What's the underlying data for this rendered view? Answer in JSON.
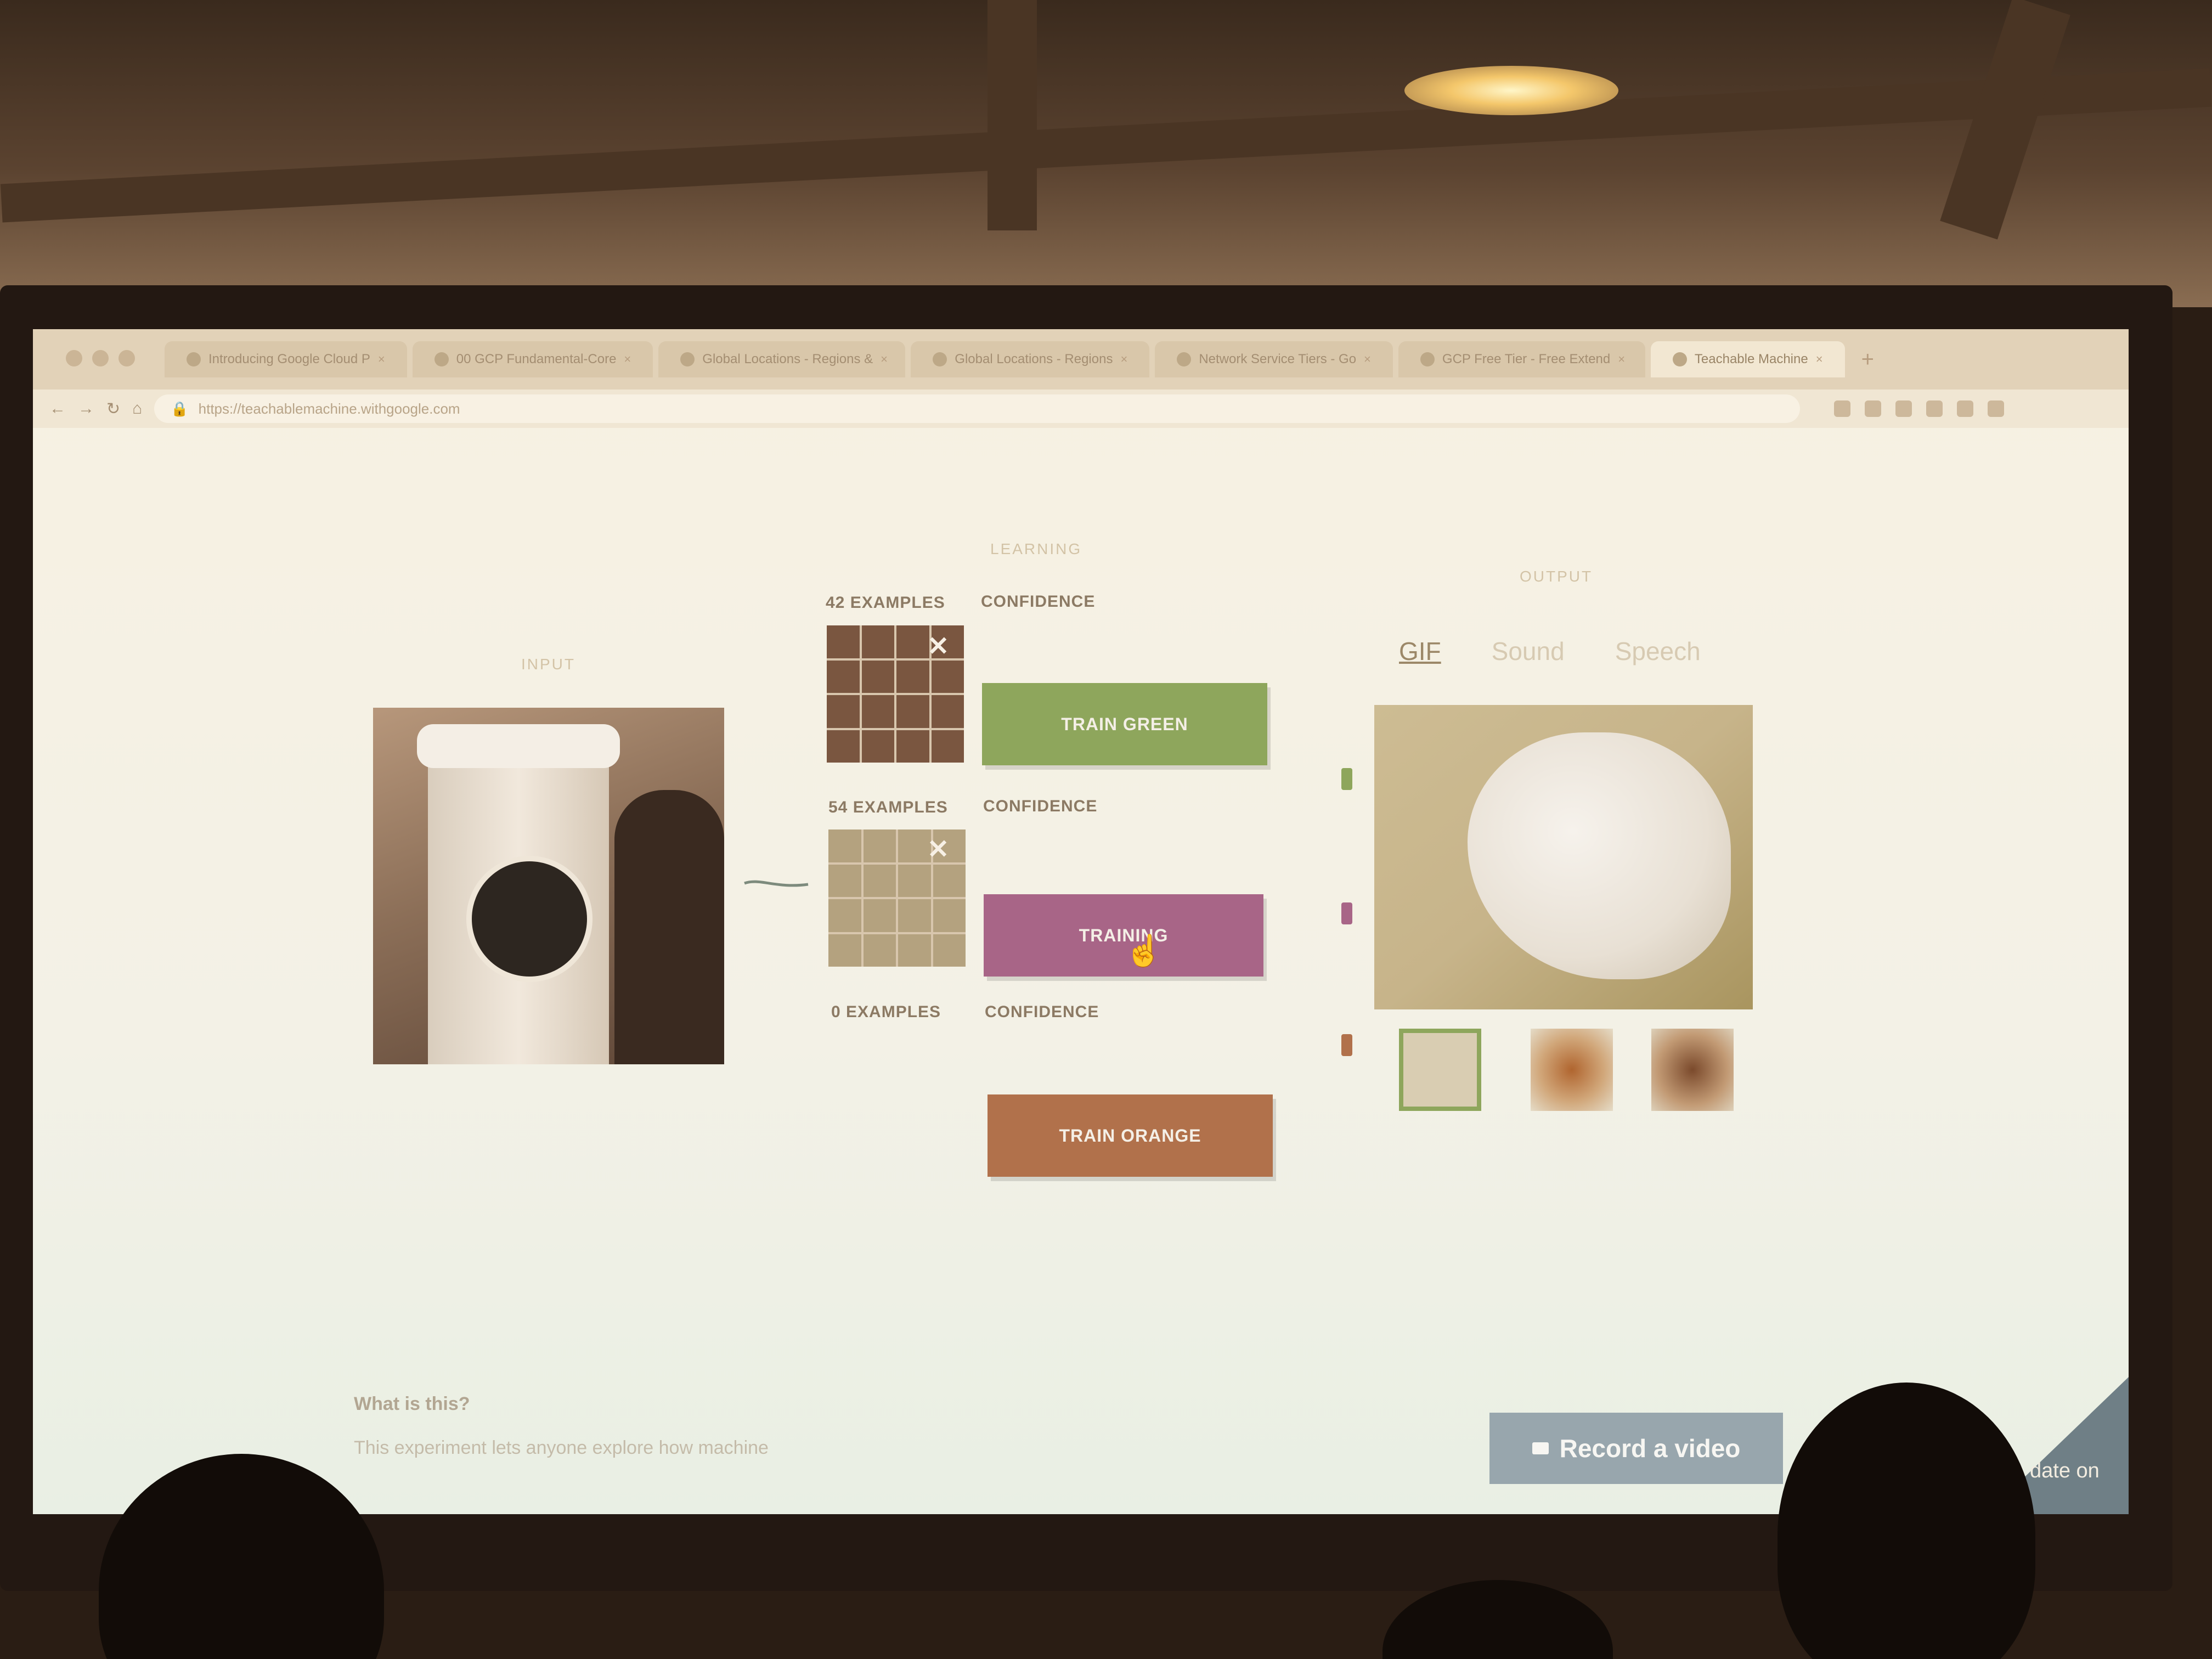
{
  "browser": {
    "tabs": [
      {
        "label": "Introducing Google Cloud P",
        "active": false
      },
      {
        "label": "00 GCP Fundamental-Core",
        "active": false
      },
      {
        "label": "Global Locations - Regions &",
        "active": false
      },
      {
        "label": "Global Locations - Regions",
        "active": false
      },
      {
        "label": "Network Service Tiers - Go",
        "active": false
      },
      {
        "label": "GCP Free Tier - Free Extend",
        "active": false
      },
      {
        "label": "Teachable Machine",
        "active": true
      }
    ],
    "tab_close": "×",
    "new_tab": "+",
    "url": "https://teachablemachine.withgoogle.com"
  },
  "page": {
    "input_label": "INPUT",
    "learning_label": "LEARNING",
    "output_label": "OUTPUT",
    "classes": [
      {
        "examples": "42 EXAMPLES",
        "confidence": "CONFIDENCE",
        "button": "TRAIN GREEN",
        "color": "#8ea65c"
      },
      {
        "examples": "54 EXAMPLES",
        "confidence": "CONFIDENCE",
        "button": "TRAINING",
        "color": "#a86587"
      },
      {
        "examples": "0 EXAMPLES",
        "confidence": "CONFIDENCE",
        "button": "TRAIN ORANGE",
        "color": "#b1714b"
      }
    ],
    "clear_icon": "✕",
    "output_tabs": [
      "GIF",
      "Sound",
      "Speech"
    ],
    "active_output_tab": "GIF",
    "about_title": "What is this?",
    "about_body": "This experiment lets anyone explore how machine",
    "record_button": "Record a video",
    "update_text": "date on"
  },
  "icons": {
    "back": "←",
    "forward": "→",
    "reload": "↻",
    "home": "⌂",
    "lock": "🔒",
    "cursor": "☝"
  }
}
